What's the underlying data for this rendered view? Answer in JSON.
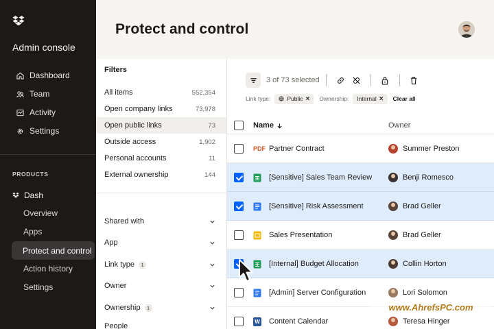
{
  "sidebar": {
    "app_title": "Admin console",
    "nav": [
      {
        "label": "Dashboard",
        "icon": "home-icon"
      },
      {
        "label": "Team",
        "icon": "team-icon"
      },
      {
        "label": "Activity",
        "icon": "activity-icon"
      },
      {
        "label": "Settings",
        "icon": "gear-icon"
      }
    ],
    "products_label": "PRODUCTS",
    "dash_label": "Dash",
    "dash_items": [
      {
        "label": "Overview"
      },
      {
        "label": "Apps"
      },
      {
        "label": "Protect and control",
        "active": true
      },
      {
        "label": "Action history"
      },
      {
        "label": "Settings"
      }
    ]
  },
  "header": {
    "title": "Protect and control"
  },
  "filters": {
    "title": "Filters",
    "items": [
      {
        "label": "All items",
        "count": "552,354"
      },
      {
        "label": "Open company links",
        "count": "73,978"
      },
      {
        "label": "Open public links",
        "count": "73",
        "selected": true
      },
      {
        "label": "Outside access",
        "count": "1,902"
      },
      {
        "label": "Personal accounts",
        "count": "11"
      },
      {
        "label": "External ownership",
        "count": "144"
      }
    ],
    "dropdowns": [
      {
        "label": "Shared with",
        "badge": ""
      },
      {
        "label": "App",
        "badge": ""
      },
      {
        "label": "Link type",
        "badge": "1"
      },
      {
        "label": "Owner",
        "badge": ""
      },
      {
        "label": "Ownership",
        "badge": "1"
      },
      {
        "label": "People",
        "badge": ""
      }
    ]
  },
  "toolbar": {
    "selection": "3 of 73 selected"
  },
  "chips": {
    "link_type_label": "Link type:",
    "link_type_value": "Public",
    "ownership_label": "Ownership:",
    "ownership_value": "Internal",
    "clear_all": "Clear all"
  },
  "table": {
    "col_name": "Name",
    "col_owner": "Owner",
    "rows": [
      {
        "name": "Partner Contract",
        "owner": "Summer Preston",
        "type": "pdf",
        "checked": false
      },
      {
        "name": "[Sensitive] Sales Team Review",
        "owner": "Benji Romesco",
        "type": "sheet",
        "checked": true
      },
      {
        "name": "[Sensitive] Risk Assessment",
        "owner": "Brad Geller",
        "type": "doc",
        "checked": true
      },
      {
        "name": "Sales Presentation",
        "owner": "Brad Geller",
        "type": "slides",
        "checked": false
      },
      {
        "name": "[Internal] Budget Allocation",
        "owner": "Collin Horton",
        "type": "sheet",
        "checked": true
      },
      {
        "name": "[Admin] Server Configuration",
        "owner": "Lori Solomon",
        "type": "doc",
        "checked": false
      },
      {
        "name": "Content Calendar",
        "owner": "Teresa Hinger",
        "type": "word",
        "checked": false
      }
    ]
  },
  "file_icon_labels": {
    "pdf": "PDF",
    "word": "W"
  },
  "watermark": "www.AhrefsPC.com",
  "colors": {
    "accent": "#0061fe",
    "sidebar": "#1e1919",
    "selected_row": "#deecfb"
  }
}
